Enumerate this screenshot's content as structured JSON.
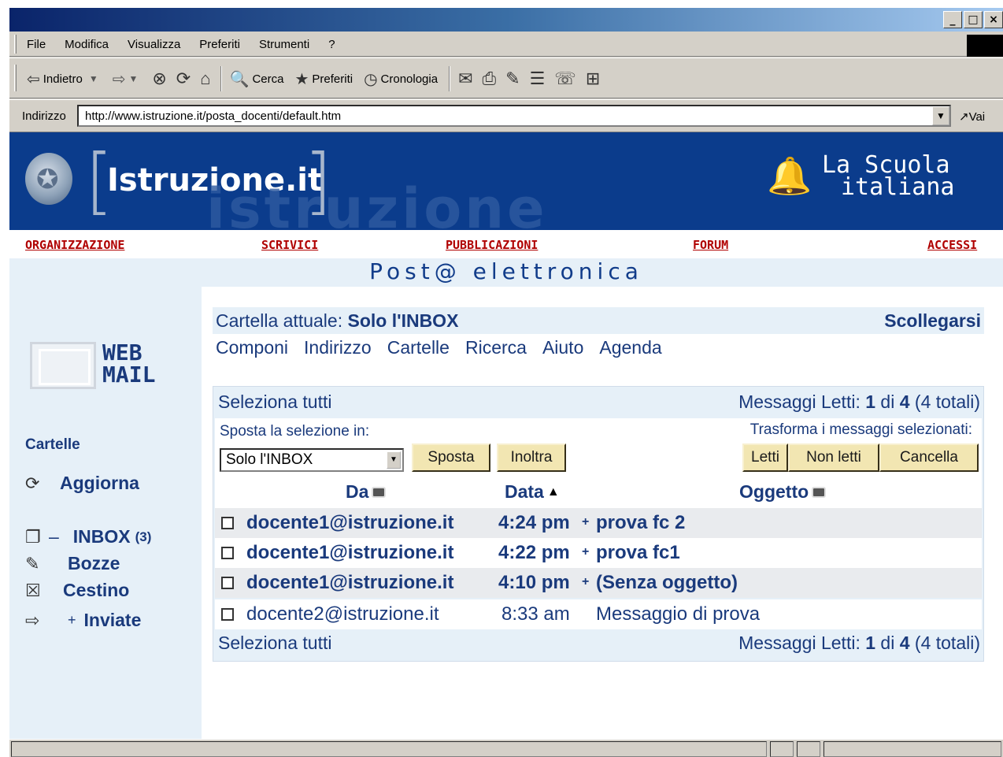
{
  "window": {
    "buttons": [
      "_",
      "□",
      "×"
    ]
  },
  "menu": {
    "items": [
      "File",
      "Modifica",
      "Visualizza",
      "Preferiti",
      "Strumenti",
      "?"
    ]
  },
  "toolbar": {
    "back_label": "Indietro",
    "search_label": "Cerca",
    "favorites_label": "Preferiti",
    "history_label": "Cronologia"
  },
  "address": {
    "label": "Indirizzo",
    "url": "http://www.istruzione.it/posta_docenti/default.htm",
    "go_label": "Vai"
  },
  "banner": {
    "brand": "Istruzione.it",
    "brand_ghost": "istruzione",
    "tagline_line1": "La Scuola",
    "tagline_line2": "italiana"
  },
  "nav": {
    "items": [
      "ORGANIZZAZIONE",
      "SCRIVICI",
      "PUBBLICAZIONI",
      "FORUM",
      "ACCESSI"
    ]
  },
  "page_title": "Post@ elettronica",
  "sidebar": {
    "logo_line1": "WEB",
    "logo_line2": "MAIL",
    "heading": "Cartelle",
    "refresh_label": "Aggiorna",
    "inbox_label": "INBOX",
    "inbox_count": "(3)",
    "drafts_label": "Bozze",
    "trash_label": "Cestino",
    "sent_label": "Inviate",
    "sent_prefix": "+",
    "inbox_prefix": "–"
  },
  "main": {
    "current_folder_label": "Cartella attuale:",
    "current_folder": "Solo l'INBOX",
    "logout_label": "Scollegarsi",
    "links": [
      "Componi",
      "Indirizzo",
      "Cartelle",
      "Ricerca",
      "Aiuto",
      "Agenda"
    ],
    "select_all": "Seleziona tutti",
    "read_count_label": "Messaggi Letti:",
    "read_count": "1",
    "of_label": "di",
    "total_count": "4",
    "total_label": "(4 totali)",
    "move_label": "Sposta la selezione in:",
    "move_target": "Solo l'INBOX",
    "move_button": "Sposta",
    "forward_button": "Inoltra",
    "transform_label": "Trasforma i messaggi selezionati:",
    "read_button": "Letti",
    "unread_button": "Non letti",
    "delete_button": "Cancella",
    "col_from": "Da",
    "col_date": "Data",
    "col_subject": "Oggetto",
    "messages": [
      {
        "from": "docente1@istruzione.it",
        "time": "4:24 pm",
        "plus": "+",
        "subject": "prova fc 2",
        "unread": true
      },
      {
        "from": "docente1@istruzione.it",
        "time": "4:22 pm",
        "plus": "+",
        "subject": "prova fc1",
        "unread": true
      },
      {
        "from": "docente1@istruzione.it",
        "time": "4:10 pm",
        "plus": "+",
        "subject": "(Senza oggetto)",
        "unread": true
      },
      {
        "from": "docente2@istruzione.it",
        "time": "8:33 am",
        "plus": "",
        "subject": "Messaggio di prova",
        "unread": false
      }
    ]
  }
}
